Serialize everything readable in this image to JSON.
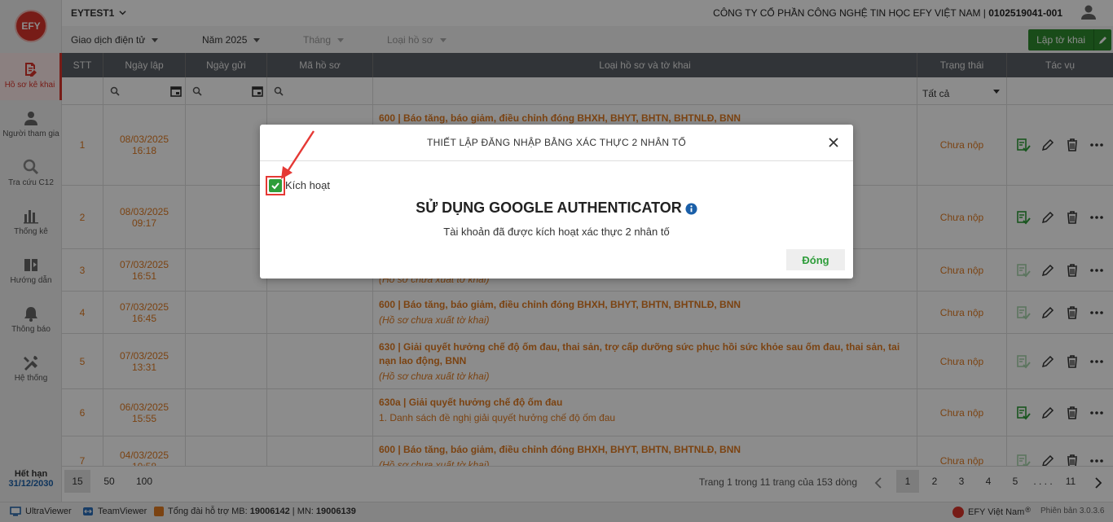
{
  "app": {
    "logo_text": "EFY",
    "account": "EYTEST1",
    "company_name": "CÔNG TY CỔ PHẦN CÔNG NGHỆ TIN HỌC EFY VIỆT NAM | ",
    "tax_code": "0102519041-001",
    "accent_color": "#d9342b",
    "primary_green": "#2e8b2e"
  },
  "sidebar": {
    "items": [
      {
        "label": "Hồ sơ kê khai",
        "icon": "document-edit-icon"
      },
      {
        "label": "Người tham gia",
        "icon": "person-icon"
      },
      {
        "label": "Tra cứu C12",
        "icon": "search-icon"
      },
      {
        "label": "Thống kê",
        "icon": "bar-chart-icon"
      },
      {
        "label": "Hướng dẫn",
        "icon": "guide-icon"
      },
      {
        "label": "Thông báo",
        "icon": "bell-icon"
      },
      {
        "label": "Hệ thống",
        "icon": "tools-icon"
      }
    ],
    "expire_label": "Hết hạn",
    "expire_date": "31/12/2030"
  },
  "filters": {
    "transaction": "Giao dịch điện tử",
    "year": "Năm 2025",
    "month": "Tháng",
    "type": "Loại hồ sơ",
    "create_button": "Lập tờ khai"
  },
  "table": {
    "headers": [
      "STT",
      "Ngày lập",
      "Ngày gửi",
      "Mã hồ sơ",
      "Loại hồ sơ và tờ khai",
      "Trạng thái",
      "Tác vụ"
    ],
    "status_filter": "Tất cả",
    "rows": [
      {
        "stt": "1",
        "date": "08/03/2025",
        "time": "16:18",
        "title": "600 | Báo tăng, báo giảm, điều chỉnh đóng BHXH, BHYT, BHTN, BHTNLĐ, BNN",
        "sub": "",
        "status": "Chưa nộp"
      },
      {
        "stt": "2",
        "date": "08/03/2025",
        "time": "09:17",
        "title": "",
        "sub": "",
        "status": "Chưa nộp"
      },
      {
        "stt": "3",
        "date": "07/03/2025",
        "time": "16:51",
        "title": "",
        "sub": "(Hồ sơ chưa xuất tờ khai)",
        "status": "Chưa nộp"
      },
      {
        "stt": "4",
        "date": "07/03/2025",
        "time": "16:45",
        "title": "600 | Báo tăng, báo giảm, điều chỉnh đóng BHXH, BHYT, BHTN, BHTNLĐ, BNN",
        "sub": "(Hồ sơ chưa xuất tờ khai)",
        "status": "Chưa nộp"
      },
      {
        "stt": "5",
        "date": "07/03/2025",
        "time": "13:31",
        "title": "630 | Giải quyết hưởng chế độ ốm đau, thai sản, trợ cấp dưỡng sức phục hồi sức khỏe sau ốm đau, thai sản, tai nạn lao động, BNN",
        "sub": "(Hồ sơ chưa xuất tờ khai)",
        "status": "Chưa nộp"
      },
      {
        "stt": "6",
        "date": "06/03/2025",
        "time": "15:55",
        "title": "630a | Giải quyết hưởng chế độ ốm đau",
        "sub": "1. Danh sách đề nghị giải quyết hưởng chế độ ốm đau",
        "status": "Chưa nộp"
      },
      {
        "stt": "7",
        "date": "04/03/2025",
        "time": "10:58",
        "title": "600 | Báo tăng, báo giảm, điều chỉnh đóng BHXH, BHYT, BHTN, BHTNLĐ, BNN",
        "sub": "(Hồ sơ chưa xuất tờ khai)",
        "status": "Chưa nộp"
      }
    ]
  },
  "pagination": {
    "sizes": [
      "15",
      "50",
      "100"
    ],
    "info": "Trang 1 trong 11 trang của 153 dòng",
    "pages": [
      "1",
      "2",
      "3",
      "4",
      "5",
      ". . . .",
      "11"
    ]
  },
  "footer": {
    "ultraviewer": "UltraViewer",
    "teamviewer": "TeamViewer",
    "hotline_prefix": "Tổng đài hỗ trợ MB: ",
    "hotline_mb": "19006142",
    "hotline_sep": " | MN: ",
    "hotline_mn": "19006139",
    "brand": "EFY Việt Nam",
    "version": "Phiên bản 3.0.3.6"
  },
  "modal": {
    "title": "THIẾT LẬP ĐĂNG NHẬP BẰNG XÁC THỰC 2 NHÂN TỐ",
    "checkbox_label": "Kích hoạt",
    "checked": true,
    "heading": "SỬ DỤNG GOOGLE AUTHENTICATOR",
    "description": "Tài khoản đã được kích hoạt xác thực 2 nhân tố",
    "close_button": "Đóng"
  }
}
